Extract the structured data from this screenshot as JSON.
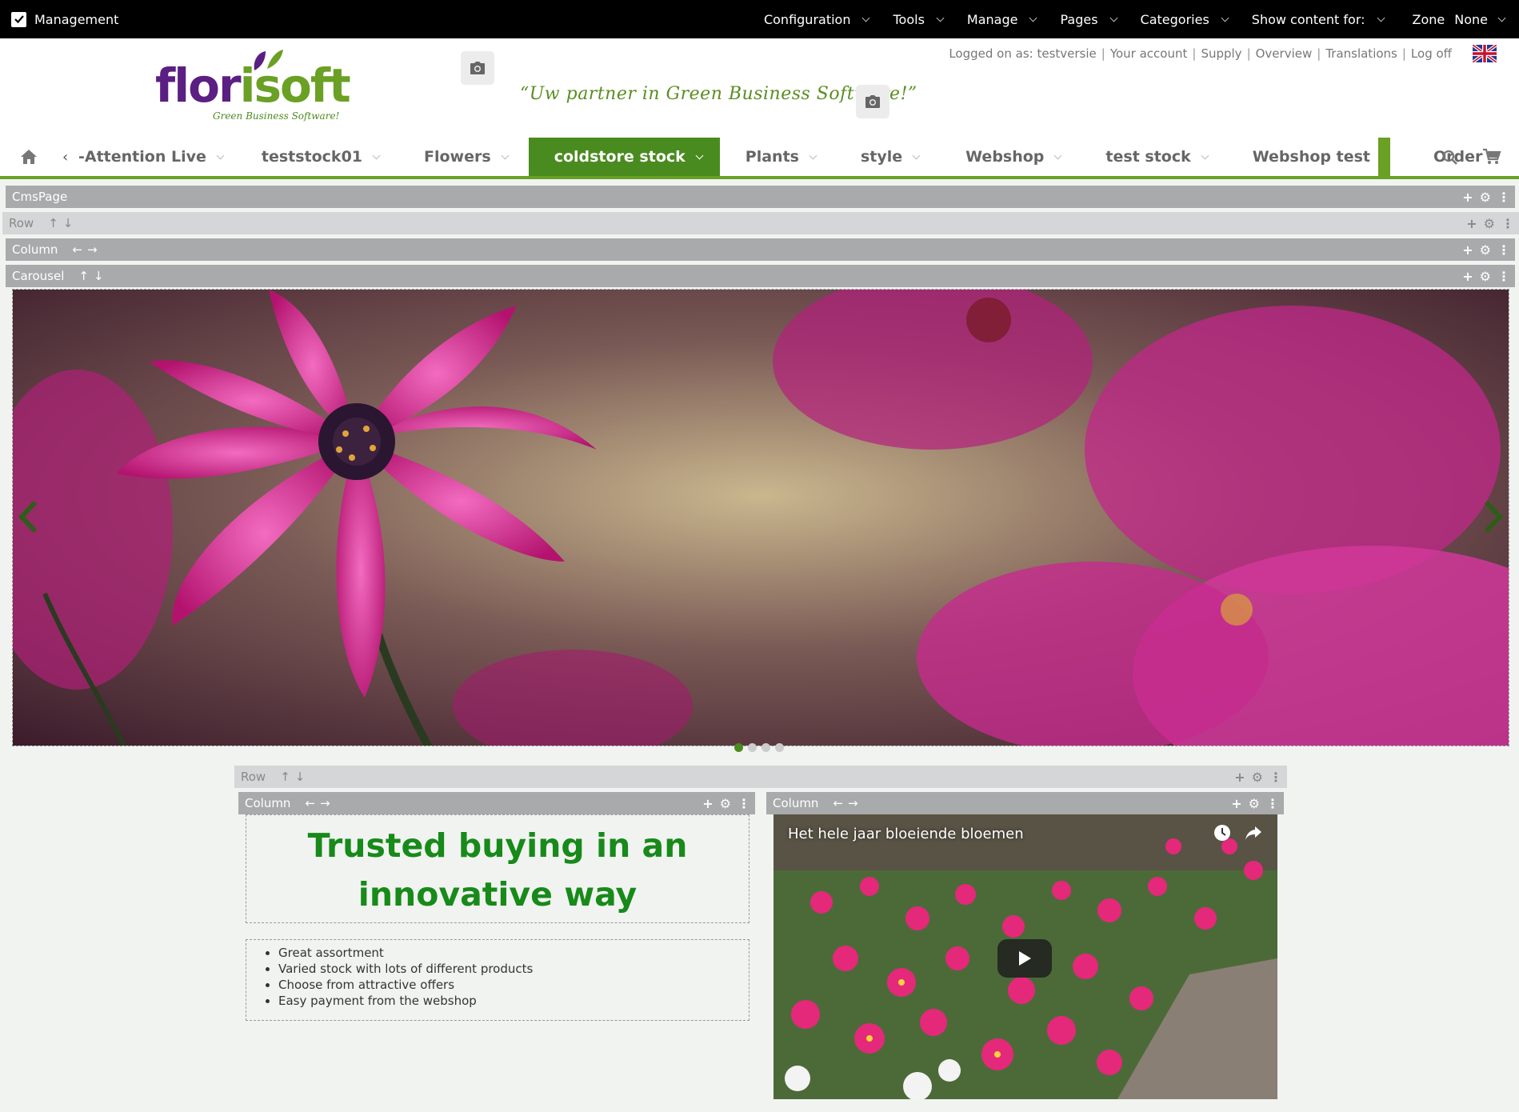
{
  "management_bar": {
    "title": "Management",
    "menu": [
      {
        "label": "Configuration"
      },
      {
        "label": "Tools"
      },
      {
        "label": "Manage"
      },
      {
        "label": "Pages"
      },
      {
        "label": "Categories"
      },
      {
        "label": "Show content for:"
      }
    ],
    "zone_label": "Zone",
    "zone_value": "None"
  },
  "header": {
    "logo_part1": "flor",
    "logo_part2": "isoft",
    "logo_subtitle": "Green Business Software!",
    "slogan": "“Uw partner in Green Business Software!”",
    "logged_on": "Logged on as: testversie",
    "links": [
      "Your account",
      "Supply",
      "Overview",
      "Translations",
      "Log off"
    ],
    "language_icon": "uk-flag-icon"
  },
  "nav": {
    "items": [
      {
        "label": "-Attention Live"
      },
      {
        "label": "teststock01"
      },
      {
        "label": "Flowers"
      },
      {
        "label": "coldstore stock"
      },
      {
        "label": "Plants"
      },
      {
        "label": "style"
      },
      {
        "label": "Webshop"
      },
      {
        "label": "test stock"
      },
      {
        "label": "Webshop test"
      },
      {
        "label": "Order"
      }
    ],
    "active_item": "coldstore stock"
  },
  "cms": {
    "page_label": "CmsPage",
    "row_label": "Row",
    "column_label": "Column",
    "carousel_label": "Carousel",
    "tool_add": "+",
    "tool_more": "⋮"
  },
  "carousel": {
    "slide_count": 4,
    "active_slide": 1
  },
  "content": {
    "headline_line1": "Trusted buying in an",
    "headline_line2": "innovative way",
    "bullets": [
      "Great assortment",
      "Varied stock with lots of different products",
      "Choose from attractive offers",
      "Easy payment from the webshop"
    ],
    "video_title": "Het hele jaar bloeiende bloemen"
  },
  "colors": {
    "brand_green": "#4a8b1f",
    "brand_purple": "#5b1f83",
    "headline_green": "#178a1a"
  }
}
